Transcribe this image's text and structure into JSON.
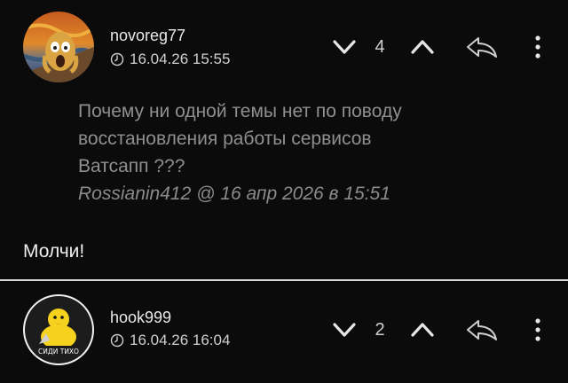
{
  "comments": [
    {
      "username": "novoreg77",
      "timestamp": "16.04.26 15:55",
      "rating": "4",
      "quote": {
        "lines": [
          "Почему ни одной темы нет по поводу",
          "восстановления работы сервисов",
          "Ватсапп ???"
        ],
        "author": "Rossianin412",
        "at": "@",
        "date": "16 апр 2026 в 15:51"
      },
      "body": "Молчи!"
    },
    {
      "username": "hook999",
      "timestamp": "16.04.26 16:04",
      "rating": "2",
      "avatar_caption": "СИДИ ТИХО"
    }
  ],
  "icons": {
    "vote_down": "chevron-down-icon",
    "vote_up": "chevron-up-icon",
    "reply": "reply-arrow-icon",
    "more": "more-vertical-icon",
    "time": "clock-icon"
  },
  "colors": {
    "background": "#0b0b0b",
    "text": "#e6e6e6",
    "muted": "#8f8f8f",
    "divider": "#d9d9d9"
  }
}
